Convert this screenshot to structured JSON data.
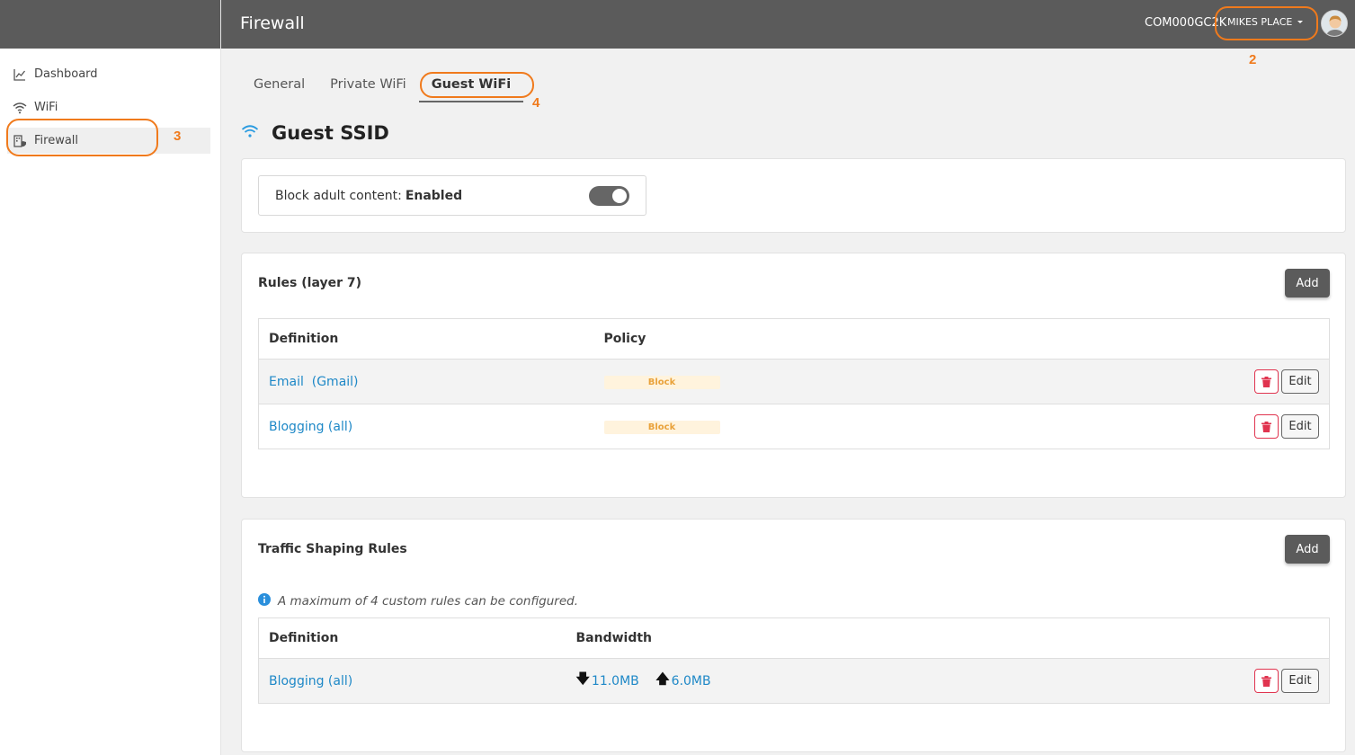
{
  "header": {
    "title": "Firewall",
    "org_code": "COM000GC2K",
    "account_name": "MIKES PLACE"
  },
  "sidebar": {
    "items": [
      {
        "label": "Dashboard",
        "icon": "chart-line-icon"
      },
      {
        "label": "WiFi",
        "icon": "wifi-icon"
      },
      {
        "label": "Firewall",
        "icon": "firewall-icon",
        "active": true
      }
    ]
  },
  "annotations": [
    "2",
    "3",
    "4"
  ],
  "tabs": [
    {
      "label": "General"
    },
    {
      "label": "Private WiFi"
    },
    {
      "label": "Guest WiFi",
      "active": true
    }
  ],
  "section": {
    "title": "Guest SSID",
    "icon": "wifi-icon"
  },
  "adult_content": {
    "label": "Block adult content:",
    "status": "Enabled",
    "enabled": true
  },
  "l7_rules": {
    "title": "Rules (layer 7)",
    "add_label": "Add",
    "columns": [
      "Definition",
      "Policy"
    ],
    "rows": [
      {
        "definition": "Email  (Gmail)",
        "policy": "Block"
      },
      {
        "definition": "Blogging (all)",
        "policy": "Block"
      }
    ],
    "edit_label": "Edit"
  },
  "traffic_shaping": {
    "title": "Traffic Shaping Rules",
    "add_label": "Add",
    "info": "A maximum of 4 custom rules can be configured.",
    "columns": [
      "Definition",
      "Bandwidth"
    ],
    "rows": [
      {
        "definition": "Blogging (all)",
        "down": "11.0MB",
        "up": "6.0MB"
      }
    ],
    "edit_label": "Edit"
  },
  "colors": {
    "header_bg": "#5b5b5b",
    "link": "#1e88c7",
    "annotation": "#f07a1c",
    "delete": "#e0344f",
    "badge_text": "#e9a23b"
  }
}
